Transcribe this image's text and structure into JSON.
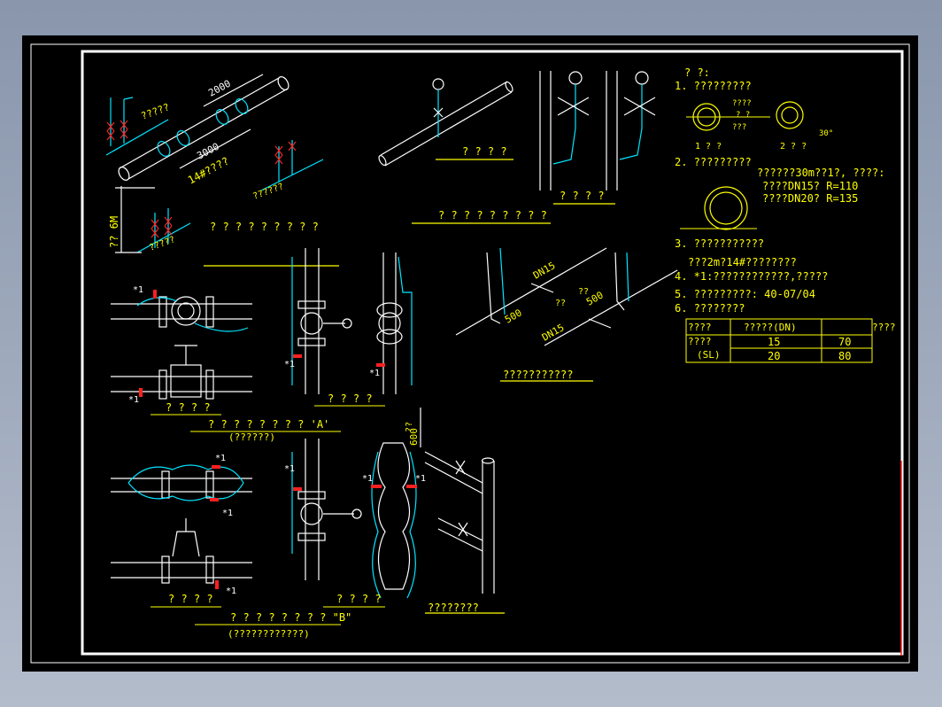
{
  "labels": {
    "sec1_caption": "? ? ? ? ? ? ? ? ?",
    "sec1_tag": "?????",
    "sec1_dim_2000": "2000",
    "sec1_dim_3000": "3000",
    "sec1_wire": "14#????",
    "sec1_tag2": "??????",
    "sec1_height": "?? 6M",
    "sec1_tag3": "?????",
    "sec2_caption_a": "? ? ? ?",
    "sec2_caption_b": "? ? ? ?",
    "sec2_caption": "? ? ? ? ? ? ? ? ?",
    "secA_caption_left": "? ? ? ?",
    "secA_caption_mid": "? ? ? ?",
    "secA_title": "? ? ? ? ? ? ? ? 'A'",
    "secA_sub": "(??????)",
    "secB_caption_left": "? ? ? ?",
    "secB_caption_mid": "? ? ? ?",
    "secB_title": "? ? ? ? ? ? ? ? \"B\"",
    "secB_sub": "(????????????)",
    "iso_caption": "???????????",
    "iso_dn15_a": "DN15",
    "iso_dn15_b": "DN15",
    "iso_500_a": "500",
    "iso_500_b": "500",
    "iso_q1": "??",
    "iso_q2": "??",
    "riser_caption": "????????",
    "riser_600": "600",
    "riser_q": "??",
    "star1": "*1"
  },
  "notes": {
    "heading": "? ?:",
    "n1": "1. ?????????",
    "fig1_a": "????",
    "fig1_b": "? ?",
    "fig1_c": "???",
    "fig1_cap": "1 ? ?",
    "fig2_cap": "2 ? ?",
    "angle": "30°",
    "n2": "2. ?????????",
    "n2_line1": "??????30m??1?, ????:",
    "n2_line2": "????DN15?    R=110",
    "n2_line3": "????DN20?    R=135",
    "n3": "3. ???????????",
    "n3_sub": "???2m?14#????????",
    "n4": "4. *1:????????????,?????",
    "n5": "5. ?????????: 40-07/04",
    "n6": "6. ????????"
  },
  "table": {
    "header": [
      "????",
      "?????(DN)",
      "",
      "????"
    ],
    "row_label_1": "????",
    "row_label_2": "(SL)",
    "rows": [
      [
        "15",
        "70"
      ],
      [
        "20",
        "80"
      ]
    ]
  },
  "colors": {
    "pipe": "#ffffff",
    "text": "#ffff00",
    "cyan": "#00e5ff",
    "red": "#ff2020"
  }
}
